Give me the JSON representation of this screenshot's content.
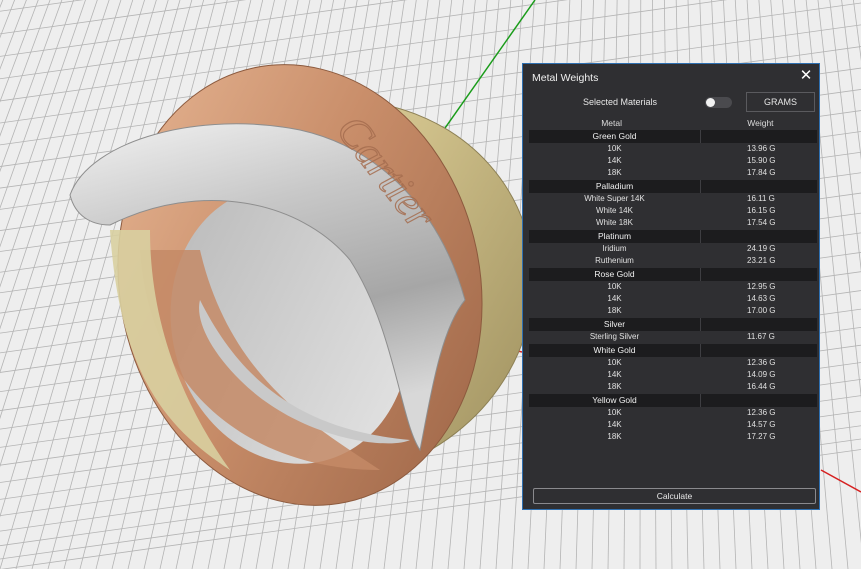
{
  "colors": {
    "panel_bg": "#2f2f32",
    "panel_border": "#2e6fb0",
    "group_bg": "#1c1c1e",
    "axis_green": "#1a9c1a",
    "axis_red": "#d62020"
  },
  "panel": {
    "title": "Metal Weights",
    "selected_materials_label": "Selected Materials",
    "toggle_on": false,
    "units_button": "GRAMS",
    "columns": {
      "metal": "Metal",
      "weight": "Weight"
    },
    "groups": [
      {
        "name": "Green Gold",
        "rows": [
          {
            "metal": "10K",
            "weight": "13.96 G"
          },
          {
            "metal": "14K",
            "weight": "15.90 G"
          },
          {
            "metal": "18K",
            "weight": "17.84 G"
          }
        ]
      },
      {
        "name": "Palladium",
        "rows": [
          {
            "metal": "White Super 14K",
            "weight": "16.11 G"
          },
          {
            "metal": "White 14K",
            "weight": "16.15 G"
          },
          {
            "metal": "White 18K",
            "weight": "17.54 G"
          }
        ]
      },
      {
        "name": "Platinum",
        "rows": [
          {
            "metal": "Iridium",
            "weight": "24.19 G"
          },
          {
            "metal": "Ruthenium",
            "weight": "23.21 G"
          }
        ]
      },
      {
        "name": "Rose Gold",
        "rows": [
          {
            "metal": "10K",
            "weight": "12.95 G"
          },
          {
            "metal": "14K",
            "weight": "14.63 G"
          },
          {
            "metal": "18K",
            "weight": "17.00 G"
          }
        ]
      },
      {
        "name": "Silver",
        "rows": [
          {
            "metal": "Sterling Silver",
            "weight": "11.67 G"
          }
        ]
      },
      {
        "name": "White Gold",
        "rows": [
          {
            "metal": "10K",
            "weight": "12.36 G"
          },
          {
            "metal": "14K",
            "weight": "14.09 G"
          },
          {
            "metal": "18K",
            "weight": "16.44 G"
          }
        ]
      },
      {
        "name": "Yellow Gold",
        "rows": [
          {
            "metal": "10K",
            "weight": "12.36 G"
          },
          {
            "metal": "14K",
            "weight": "14.57 G"
          },
          {
            "metal": "18K",
            "weight": "17.27 G"
          }
        ]
      }
    ],
    "calculate_button": "Calculate"
  },
  "ring_engraving": "Cartier",
  "icons": {
    "close": "close-icon"
  }
}
